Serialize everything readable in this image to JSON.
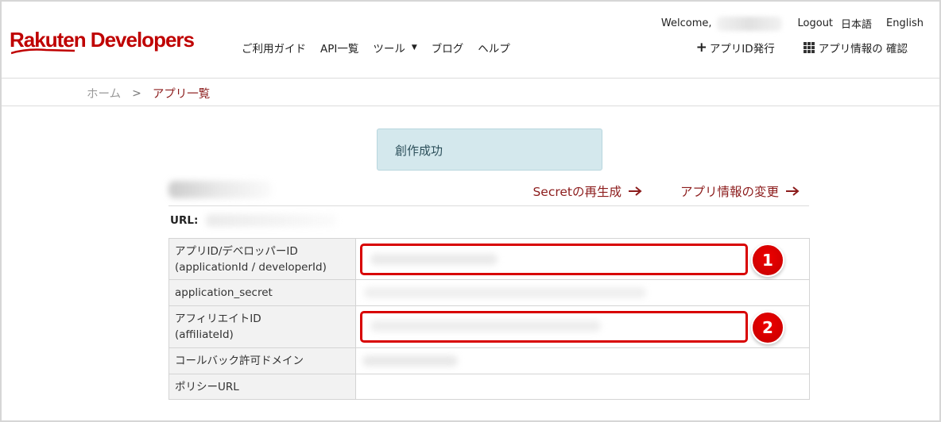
{
  "header": {
    "logo_text": "Rakuten Developers",
    "nav": [
      {
        "label": "ご利用ガイド"
      },
      {
        "label": "API一覧"
      },
      {
        "label": "ツール"
      },
      {
        "label": "ブログ"
      },
      {
        "label": "ヘルプ"
      }
    ],
    "welcome": "Welcome,",
    "logout": "Logout",
    "lang_ja": "日本語",
    "lang_en": "English",
    "issue_app_id": "アプリID発行",
    "check_app_info": "アプリ情報の 確認"
  },
  "breadcrumb": {
    "home": "ホーム",
    "separator": ">",
    "current": "アプリ一覧"
  },
  "alert": {
    "message": "創作成功"
  },
  "app": {
    "regenerate_secret": "Secretの再生成",
    "edit_app_info": "アプリ情報の変更",
    "url_label": "URL:"
  },
  "table": {
    "rows": [
      {
        "label_line1": "アプリID/デベロッパーID",
        "label_line2": "(applicationId / developerId)",
        "badge": "1"
      },
      {
        "label_line1": "application_secret"
      },
      {
        "label_line1": "アフィリエイトID",
        "label_line2": "(affiliateId)",
        "badge": "2"
      },
      {
        "label_line1": "コールバック許可ドメイン"
      },
      {
        "label_line1": "ポリシーURL"
      }
    ]
  },
  "colors": {
    "brand": "#bf0000",
    "link": "#8c1c1c",
    "alert_bg": "#d4e8ed",
    "highlight": "#d80000"
  }
}
